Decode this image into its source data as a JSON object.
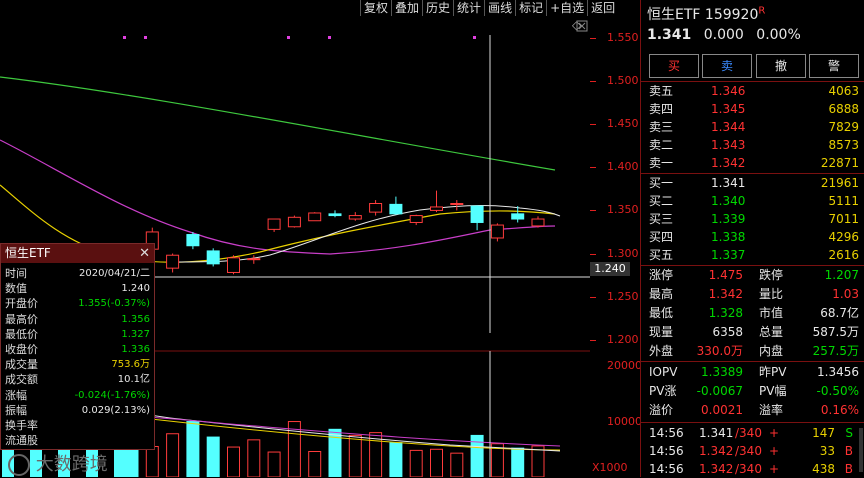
{
  "toolbar": {
    "items": [
      "复权",
      "叠加",
      "历史",
      "统计",
      "画线",
      "标记",
      "+自选",
      "返回"
    ]
  },
  "price_axis": {
    "ticks": [
      "1.550",
      "1.500",
      "1.450",
      "1.400",
      "1.350",
      "1.300",
      "1.250",
      "1.200"
    ],
    "crosshair_price": "1.240"
  },
  "volume_axis": {
    "ticks": [
      "20000",
      "10000"
    ],
    "unit": "X1000"
  },
  "watermark": "大数跨境",
  "infobox": {
    "title": "恒生ETF",
    "rows": [
      {
        "label": "时间",
        "value": "2020/04/21/二"
      },
      {
        "label": "数值",
        "value": "1.240"
      },
      {
        "label": "开盘价",
        "value": "1.355(-0.37%)"
      },
      {
        "label": "最高价",
        "value": "1.356"
      },
      {
        "label": "最低价",
        "value": "1.327"
      },
      {
        "label": "收盘价",
        "value": "1.336"
      },
      {
        "label": "成交量",
        "value": "753.6万"
      },
      {
        "label": "成交额",
        "value": "10.1亿"
      },
      {
        "label": "涨幅",
        "value": "-0.024(-1.76%)"
      },
      {
        "label": "振幅",
        "value": "0.029(2.13%)"
      },
      {
        "label": "换手率",
        "value": ""
      },
      {
        "label": "流通股",
        "value": ""
      }
    ]
  },
  "quote": {
    "name": "恒生ETF",
    "code": "159920",
    "tag": "R",
    "price": "1.341",
    "change": "0.000",
    "change_pct": "0.00%",
    "buttons": [
      "买",
      "卖",
      "撤",
      "警"
    ]
  },
  "order_book": {
    "asks": [
      {
        "label": "卖五",
        "price": "1.346",
        "vol": "4063"
      },
      {
        "label": "卖四",
        "price": "1.345",
        "vol": "6888"
      },
      {
        "label": "卖三",
        "price": "1.344",
        "vol": "7829"
      },
      {
        "label": "卖二",
        "price": "1.343",
        "vol": "8573"
      },
      {
        "label": "卖一",
        "price": "1.342",
        "vol": "22871"
      }
    ],
    "bids": [
      {
        "label": "买一",
        "price": "1.341",
        "vol": "21961"
      },
      {
        "label": "买二",
        "price": "1.340",
        "vol": "5111"
      },
      {
        "label": "买三",
        "price": "1.339",
        "vol": "7011"
      },
      {
        "label": "买四",
        "price": "1.338",
        "vol": "4296"
      },
      {
        "label": "买五",
        "price": "1.337",
        "vol": "2616"
      }
    ]
  },
  "stats": [
    {
      "l1": "涨停",
      "v1": "1.475",
      "c1": "red",
      "l2": "跌停",
      "v2": "1.207",
      "c2": "grn"
    },
    {
      "l1": "最高",
      "v1": "1.342",
      "c1": "red",
      "l2": "量比",
      "v2": "1.03",
      "c2": "red"
    },
    {
      "l1": "最低",
      "v1": "1.328",
      "c1": "grn",
      "l2": "市值",
      "v2": "68.7亿",
      "c2": "wht"
    },
    {
      "l1": "现量",
      "v1": "6358",
      "c1": "wht",
      "l2": "总量",
      "v2": "587.5万",
      "c2": "wht"
    },
    {
      "l1": "外盘",
      "v1": "330.0万",
      "c1": "red",
      "l2": "内盘",
      "v2": "257.5万",
      "c2": "grn"
    }
  ],
  "iopv": [
    {
      "l1": "IOPV",
      "v1": "1.3389",
      "c1": "grn",
      "l2": "昨PV",
      "v2": "1.3456",
      "c2": "wht"
    },
    {
      "l1": "PV涨",
      "v1": "-0.0067",
      "c1": "grn",
      "l2": "PV幅",
      "v2": "-0.50%",
      "c2": "grn"
    },
    {
      "l1": "溢价",
      "v1": "0.0021",
      "c1": "red",
      "l2": "溢率",
      "v2": "0.16%",
      "c2": "red"
    }
  ],
  "ticks": [
    {
      "time": "14:56",
      "price": "1.341",
      "vol": "/340",
      "sign": "+",
      "qty": "147",
      "side": "S",
      "pc": "wht",
      "sc": "grn"
    },
    {
      "time": "14:56",
      "price": "1.342",
      "vol": "/340",
      "sign": "+",
      "qty": "33",
      "side": "B",
      "pc": "red",
      "sc": "red"
    },
    {
      "time": "14:56",
      "price": "1.342",
      "vol": "/340",
      "sign": "+",
      "qty": "438",
      "side": "B",
      "pc": "red",
      "sc": "red"
    }
  ],
  "chart_data": {
    "type": "candlestick",
    "candles": [
      {
        "o": 1.29,
        "h": 1.296,
        "l": 1.28,
        "c": 1.283
      },
      {
        "o": 1.305,
        "h": 1.33,
        "l": 1.302,
        "c": 1.325
      },
      {
        "o": 1.283,
        "h": 1.3,
        "l": 1.278,
        "c": 1.298
      },
      {
        "o": 1.322,
        "h": 1.325,
        "l": 1.305,
        "c": 1.309
      },
      {
        "o": 1.303,
        "h": 1.306,
        "l": 1.285,
        "c": 1.288
      },
      {
        "o": 1.278,
        "h": 1.298,
        "l": 1.276,
        "c": 1.295
      },
      {
        "o": 1.293,
        "h": 1.298,
        "l": 1.288,
        "c": 1.294
      },
      {
        "o": 1.328,
        "h": 1.34,
        "l": 1.325,
        "c": 1.34
      },
      {
        "o": 1.331,
        "h": 1.344,
        "l": 1.33,
        "c": 1.342
      },
      {
        "o": 1.338,
        "h": 1.348,
        "l": 1.338,
        "c": 1.347
      },
      {
        "o": 1.346,
        "h": 1.35,
        "l": 1.342,
        "c": 1.344
      },
      {
        "o": 1.34,
        "h": 1.348,
        "l": 1.338,
        "c": 1.344
      },
      {
        "o": 1.348,
        "h": 1.362,
        "l": 1.344,
        "c": 1.358
      },
      {
        "o": 1.357,
        "h": 1.366,
        "l": 1.345,
        "c": 1.346
      },
      {
        "o": 1.336,
        "h": 1.345,
        "l": 1.333,
        "c": 1.344
      },
      {
        "o": 1.35,
        "h": 1.373,
        "l": 1.348,
        "c": 1.354
      },
      {
        "o": 1.357,
        "h": 1.362,
        "l": 1.35,
        "c": 1.358
      },
      {
        "o": 1.355,
        "h": 1.356,
        "l": 1.327,
        "c": 1.336
      },
      {
        "o": 1.318,
        "h": 1.335,
        "l": 1.314,
        "c": 1.333
      },
      {
        "o": 1.346,
        "h": 1.355,
        "l": 1.336,
        "c": 1.34
      },
      {
        "o": 1.332,
        "h": 1.343,
        "l": 1.33,
        "c": 1.34
      }
    ],
    "volumes": [
      9500,
      5500,
      7800,
      10000,
      7200,
      5400,
      6700,
      4500,
      10000,
      4600,
      8600,
      7500,
      8000,
      6200,
      4800,
      5000,
      4300,
      7500,
      6000,
      5200,
      5600
    ],
    "ylim": [
      1.16,
      1.57
    ],
    "vol_ylim": [
      0,
      22000
    ]
  }
}
